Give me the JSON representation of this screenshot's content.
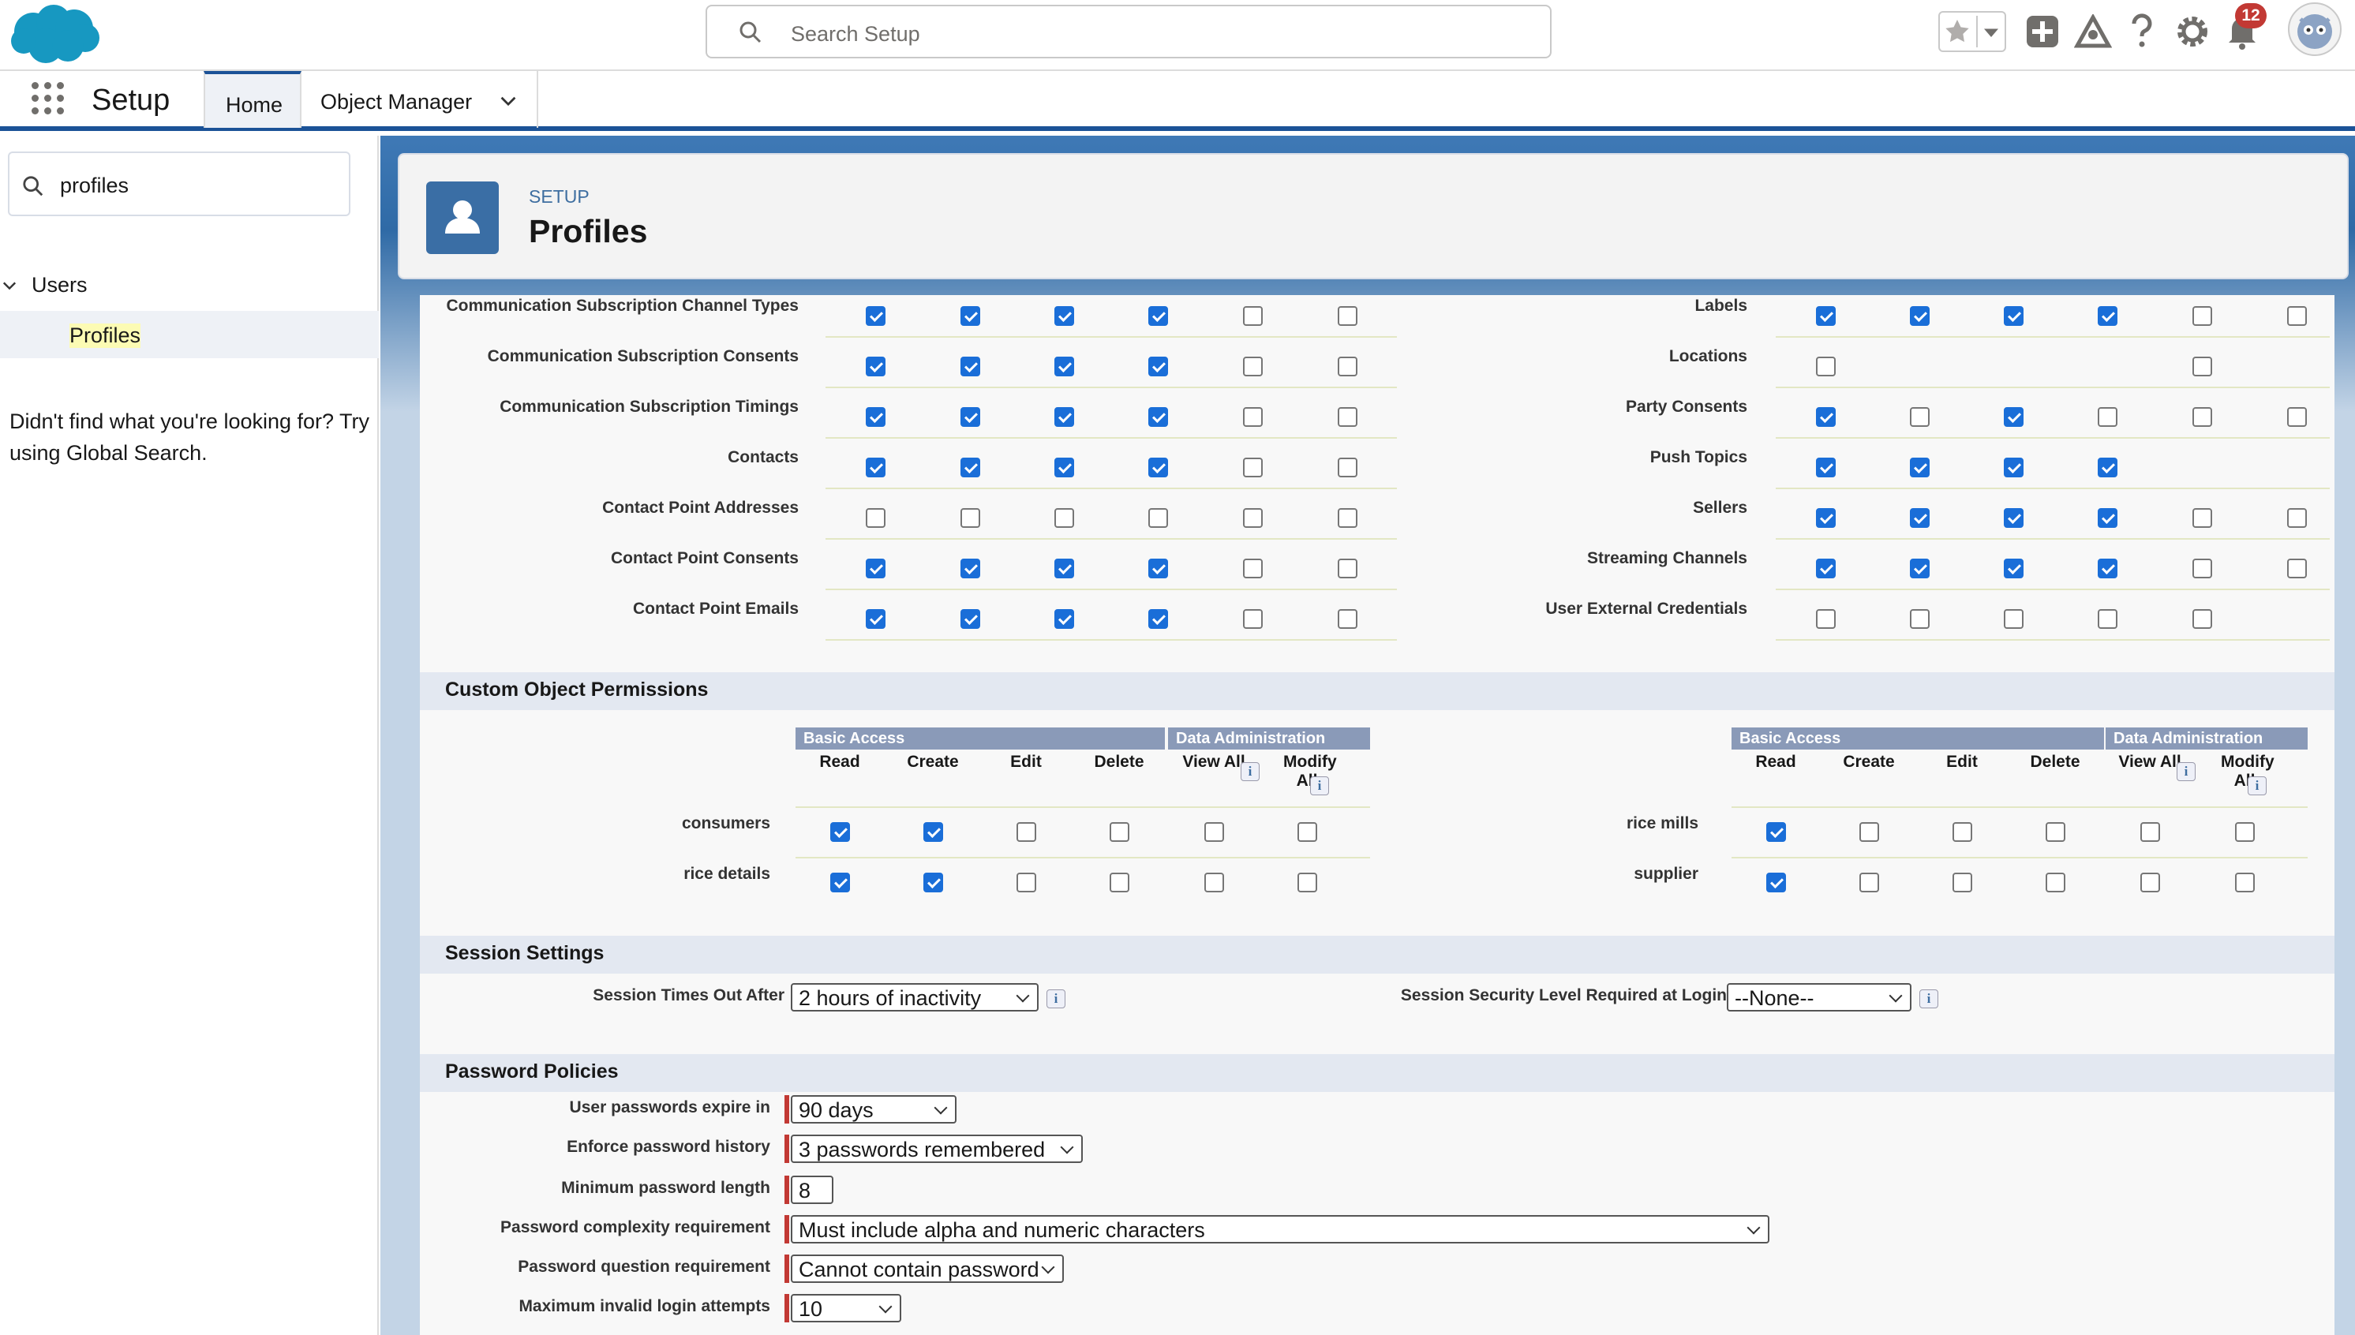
{
  "header": {
    "search_placeholder": "Search Setup",
    "notification_count": "12",
    "app_name": "Setup",
    "tabs": [
      "Home",
      "Object Manager"
    ]
  },
  "sidebar": {
    "quick_find_value": "profiles",
    "tree_parent": "Users",
    "tree_child": "Profiles",
    "not_found_text": "Didn't find what you're looking for? Try using Global Search."
  },
  "page": {
    "eyebrow": "SETUP",
    "title": "Profiles"
  },
  "standard_objects_left": [
    {
      "label": "Communication Subscription Channel Types",
      "checks": [
        1,
        1,
        1,
        1,
        0,
        0
      ]
    },
    {
      "label": "Communication Subscription Consents",
      "checks": [
        1,
        1,
        1,
        1,
        0,
        0
      ]
    },
    {
      "label": "Communication Subscription Timings",
      "checks": [
        1,
        1,
        1,
        1,
        0,
        0
      ]
    },
    {
      "label": "Contacts",
      "checks": [
        1,
        1,
        1,
        1,
        0,
        0
      ]
    },
    {
      "label": "Contact Point Addresses",
      "checks": [
        0,
        0,
        0,
        0,
        0,
        0
      ]
    },
    {
      "label": "Contact Point Consents",
      "checks": [
        1,
        1,
        1,
        1,
        0,
        0
      ]
    },
    {
      "label": "Contact Point Emails",
      "checks": [
        1,
        1,
        1,
        1,
        0,
        0
      ]
    }
  ],
  "standard_objects_right": [
    {
      "label": "Labels",
      "checks": [
        1,
        1,
        1,
        1,
        0,
        0
      ]
    },
    {
      "label": "Locations",
      "checks": [
        0,
        null,
        null,
        null,
        0,
        null
      ]
    },
    {
      "label": "Party Consents",
      "checks": [
        1,
        0,
        1,
        0,
        0,
        0
      ]
    },
    {
      "label": "Push Topics",
      "checks": [
        1,
        1,
        1,
        1,
        null,
        null
      ]
    },
    {
      "label": "Sellers",
      "checks": [
        1,
        1,
        1,
        1,
        0,
        0
      ]
    },
    {
      "label": "Streaming Channels",
      "checks": [
        1,
        1,
        1,
        1,
        0,
        0
      ]
    },
    {
      "label": "User External Credentials",
      "checks": [
        0,
        0,
        0,
        0,
        0,
        null
      ]
    }
  ],
  "custom_object_permissions": {
    "title": "Custom Object Permissions",
    "group_basic": "Basic Access",
    "group_admin": "Data Administration",
    "columns": [
      "Read",
      "Create",
      "Edit",
      "Delete",
      "View All",
      "Modify All"
    ],
    "left": [
      {
        "label": "consumers",
        "checks": [
          1,
          1,
          0,
          0,
          0,
          0
        ]
      },
      {
        "label": "rice details",
        "checks": [
          1,
          1,
          0,
          0,
          0,
          0
        ]
      }
    ],
    "right": [
      {
        "label": "rice mills",
        "checks": [
          1,
          0,
          0,
          0,
          0,
          0
        ]
      },
      {
        "label": "supplier",
        "checks": [
          1,
          0,
          0,
          0,
          0,
          0
        ]
      }
    ]
  },
  "session_settings": {
    "title": "Session Settings",
    "timeout_label": "Session Times Out After",
    "timeout_value": "2 hours of inactivity",
    "security_label": "Session Security Level Required at Login",
    "security_value": "--None--"
  },
  "password_policies": {
    "title": "Password Policies",
    "fields": [
      {
        "label": "User passwords expire in",
        "value": "90 days"
      },
      {
        "label": "Enforce password history",
        "value": "3 passwords remembered"
      },
      {
        "label": "Minimum password length",
        "value": "8"
      },
      {
        "label": "Password complexity requirement",
        "value": "Must include alpha and numeric characters"
      },
      {
        "label": "Password question requirement",
        "value": "Cannot contain password"
      },
      {
        "label": "Maximum invalid login attempts",
        "value": "10"
      }
    ]
  },
  "colors": {
    "brand_blue": "#1b5297",
    "checkbox_blue": "#1a6ed8",
    "required_red": "#c23934",
    "cloud_blue": "#1798c1"
  }
}
